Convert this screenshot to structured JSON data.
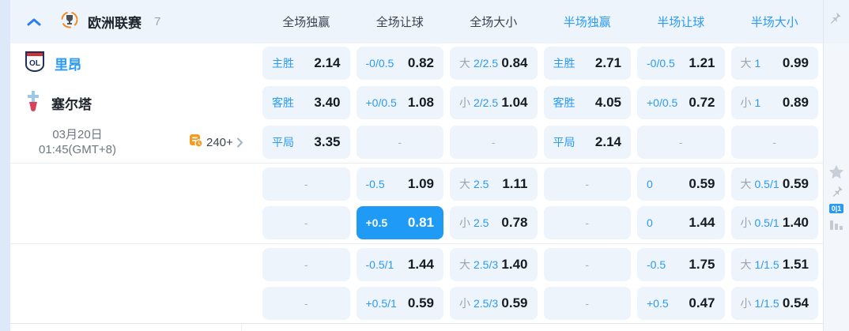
{
  "header": {
    "league": "欧洲联赛",
    "count": "7",
    "columns": [
      "全场独赢",
      "全场让球",
      "全场大小",
      "半场独赢",
      "半场让球",
      "半场大小"
    ]
  },
  "match": {
    "home_team": "里昂",
    "away_team": "塞尔塔",
    "date_line1": "03月20日",
    "date_line2": "01:45(GMT+8)",
    "more_markets": "240+"
  },
  "dash": "-",
  "colors": {
    "accent_blue": "#2b9af3",
    "highlight_cell": "#1f9bf5",
    "cell_bg": "#edf4fc",
    "header_bg": "#eef4fc"
  },
  "side": {
    "badge": "0|1"
  },
  "blocks": [
    {
      "rows": [
        [
          {
            "l2": "主胜",
            "odds": "2.14"
          },
          {
            "l2": "-0/0.5",
            "odds": "0.82"
          },
          {
            "l1": "大",
            "l2": "2/2.5",
            "odds": "0.84"
          },
          {
            "l2": "主胜",
            "odds": "2.71"
          },
          {
            "l2": "-0/0.5",
            "odds": "1.21"
          },
          {
            "l1": "大",
            "l2": "1",
            "odds": "0.99"
          }
        ],
        [
          {
            "l2": "客胜",
            "odds": "3.40"
          },
          {
            "l2": "+0/0.5",
            "odds": "1.08"
          },
          {
            "l1": "小",
            "l2": "2/2.5",
            "odds": "1.04"
          },
          {
            "l2": "客胜",
            "odds": "4.05"
          },
          {
            "l2": "+0/0.5",
            "odds": "0.72"
          },
          {
            "l1": "小",
            "l2": "1",
            "odds": "0.89"
          }
        ],
        [
          {
            "l2": "平局",
            "odds": "3.35"
          },
          {
            "dash": true
          },
          {
            "dash": true
          },
          {
            "l2": "平局",
            "odds": "2.14"
          },
          {
            "dash": true
          },
          {
            "dash": true
          }
        ]
      ]
    },
    {
      "rows": [
        [
          {
            "dash": true
          },
          {
            "l2": "-0.5",
            "odds": "1.09"
          },
          {
            "l1": "大",
            "l2": "2.5",
            "odds": "1.11"
          },
          {
            "dash": true
          },
          {
            "l2": "0",
            "odds": "0.59"
          },
          {
            "l1": "大",
            "l2": "0.5/1",
            "odds": "0.59"
          }
        ],
        [
          {
            "dash": true
          },
          {
            "l2": "+0.5",
            "odds": "0.81",
            "hl": true
          },
          {
            "l1": "小",
            "l2": "2.5",
            "odds": "0.78"
          },
          {
            "dash": true
          },
          {
            "l2": "0",
            "odds": "1.44"
          },
          {
            "l1": "小",
            "l2": "0.5/1",
            "odds": "1.40"
          }
        ]
      ]
    },
    {
      "rows": [
        [
          {
            "dash": true
          },
          {
            "l2": "-0.5/1",
            "odds": "1.44"
          },
          {
            "l1": "大",
            "l2": "2.5/3",
            "odds": "1.40"
          },
          {
            "dash": true
          },
          {
            "l2": "-0.5",
            "odds": "1.75"
          },
          {
            "l1": "大",
            "l2": "1/1.5",
            "odds": "1.51"
          }
        ],
        [
          {
            "dash": true
          },
          {
            "l2": "+0.5/1",
            "odds": "0.59"
          },
          {
            "l1": "小",
            "l2": "2.5/3",
            "odds": "0.59"
          },
          {
            "dash": true
          },
          {
            "l2": "+0.5",
            "odds": "0.47"
          },
          {
            "l1": "小",
            "l2": "1/1.5",
            "odds": "0.54"
          }
        ]
      ]
    }
  ]
}
